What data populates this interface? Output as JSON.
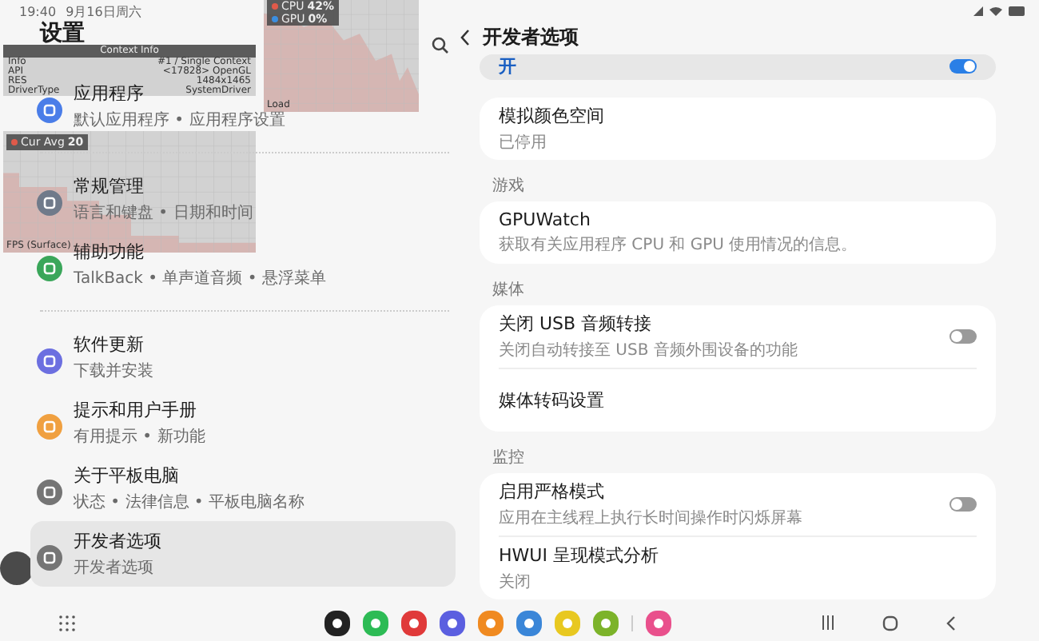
{
  "status_bar": {
    "time": "19:40",
    "date": "9月16日周六"
  },
  "settings": {
    "title": "设置",
    "groups": [
      [
        {
          "title": "应用程序",
          "subtitle": "默认应用程序 • 应用程序设置",
          "color": "#4a7de8",
          "selected": false
        }
      ],
      [
        {
          "title": "常规管理",
          "subtitle": "语言和键盘 • 日期和时间",
          "color": "#707a8a",
          "selected": false
        },
        {
          "title": "辅助功能",
          "subtitle": "TalkBack • 单声道音频 • 悬浮菜单",
          "color": "#3aa65a",
          "selected": false
        }
      ],
      [
        {
          "title": "软件更新",
          "subtitle": "下载并安装",
          "color": "#6c6fe0",
          "selected": false
        },
        {
          "title": "提示和用户手册",
          "subtitle": "有用提示 • 新功能",
          "color": "#f0a040",
          "selected": false
        },
        {
          "title": "关于平板电脑",
          "subtitle": "状态 • 法律信息 • 平板电脑名称",
          "color": "#757575",
          "selected": false
        },
        {
          "title": "开发者选项",
          "subtitle": "开发者选项",
          "color": "#757575",
          "selected": true
        }
      ]
    ]
  },
  "developer": {
    "title": "开发者选项",
    "master": {
      "label": "开",
      "on": true
    },
    "sections": [
      {
        "rows": [
          {
            "title": "模拟颜色空间",
            "subtitle": "已停用",
            "kind": "plain"
          }
        ]
      },
      {
        "header": "游戏",
        "rows": [
          {
            "title": "GPUWatch",
            "subtitle": "获取有关应用程序 CPU 和 GPU 使用情况的信息。",
            "kind": "plain"
          }
        ]
      },
      {
        "header": "媒体",
        "rows": [
          {
            "title": "关闭 USB 音频转接",
            "subtitle": "关闭自动转接至 USB 音频外围设备的功能",
            "kind": "switch",
            "on": false
          },
          {
            "title": "媒体转码设置",
            "kind": "plain"
          }
        ]
      },
      {
        "header": "监控",
        "rows": [
          {
            "title": "启用严格模式",
            "subtitle": "应用在主线程上执行长时间操作时闪烁屏幕",
            "kind": "switch",
            "on": false
          },
          {
            "title": "HWUI 呈现模式分析",
            "subtitle": "关闭",
            "kind": "plain"
          }
        ]
      }
    ]
  },
  "gpuwatch": {
    "context_info": {
      "title": "Context Info",
      "rows": [
        {
          "key": "Info",
          "value": "#1 / Single Context"
        },
        {
          "key": "API",
          "value": "<17828> OpenGL"
        },
        {
          "key": "RES",
          "value": "1484x1465"
        },
        {
          "key": "DriverType",
          "value": "SystemDriver"
        }
      ]
    },
    "fps": {
      "legend": "Cur Avg",
      "value": "20",
      "caption": "FPS (Surface)"
    },
    "load": {
      "series": [
        {
          "name": "CPU",
          "value": "42%",
          "color": "#e05a4a"
        },
        {
          "name": "GPU",
          "value": "0%",
          "color": "#3b8ee0"
        }
      ],
      "caption": "Load"
    }
  },
  "dock": {
    "apps": [
      {
        "color": "#222222"
      },
      {
        "color": "#2dbb55"
      },
      {
        "color": "#e03a3a"
      },
      {
        "color": "#5b5fe0"
      },
      {
        "color": "#f08a20"
      },
      {
        "color": "#3a86d8"
      },
      {
        "color": "#e8c820"
      },
      {
        "color": "#7cb32a"
      }
    ],
    "recent": [
      {
        "color": "#e9508c"
      }
    ]
  }
}
